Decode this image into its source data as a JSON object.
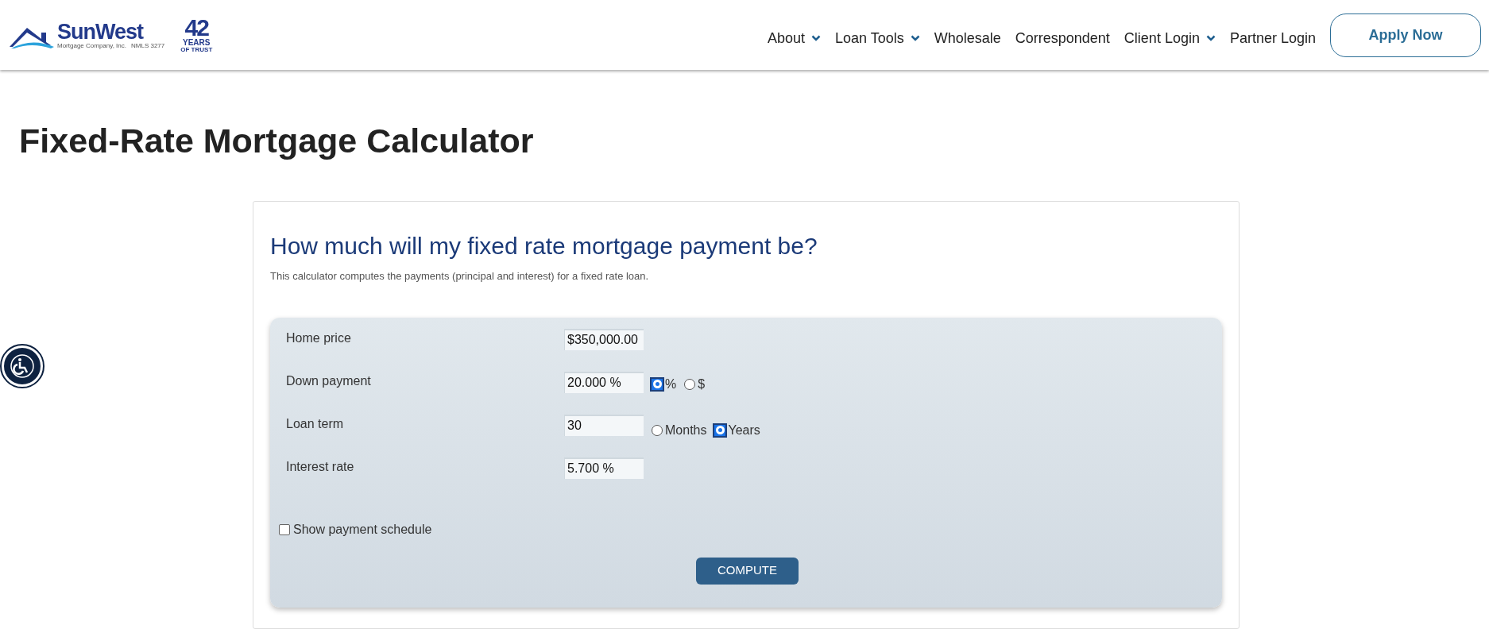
{
  "logo": {
    "name": "SunWest",
    "tagline": "Mortgage Company, Inc.",
    "nmls": "NMLS 3277",
    "years": "42",
    "years_label": "YEARS",
    "trust_label": "OF TRUST"
  },
  "nav": [
    {
      "label": "About",
      "dropdown": true
    },
    {
      "label": "Loan Tools",
      "dropdown": true
    },
    {
      "label": "Wholesale",
      "dropdown": false
    },
    {
      "label": "Correspondent",
      "dropdown": false
    },
    {
      "label": "Client Login",
      "dropdown": true
    },
    {
      "label": "Partner Login",
      "dropdown": false
    }
  ],
  "apply_button": "Apply Now",
  "page_title": "Fixed-Rate Mortgage Calculator",
  "calculator": {
    "heading": "How much will my fixed rate mortgage payment be?",
    "description": "This calculator computes the payments (principal and interest) for a fixed rate loan.",
    "fields": [
      {
        "label": "Home price",
        "value": "$350,000.00"
      },
      {
        "label": "Down payment",
        "value": "20.000 %",
        "options": [
          {
            "label": "%",
            "selected": true
          },
          {
            "label": "$",
            "selected": false
          }
        ]
      },
      {
        "label": "Loan term",
        "value": "30",
        "options": [
          {
            "label": "Months",
            "selected": false
          },
          {
            "label": "Years",
            "selected": true
          }
        ]
      },
      {
        "label": "Interest rate",
        "value": "5.700 %"
      }
    ],
    "schedule": {
      "label": "Show payment schedule",
      "checked": false
    },
    "compute_button": "COMPUTE"
  }
}
